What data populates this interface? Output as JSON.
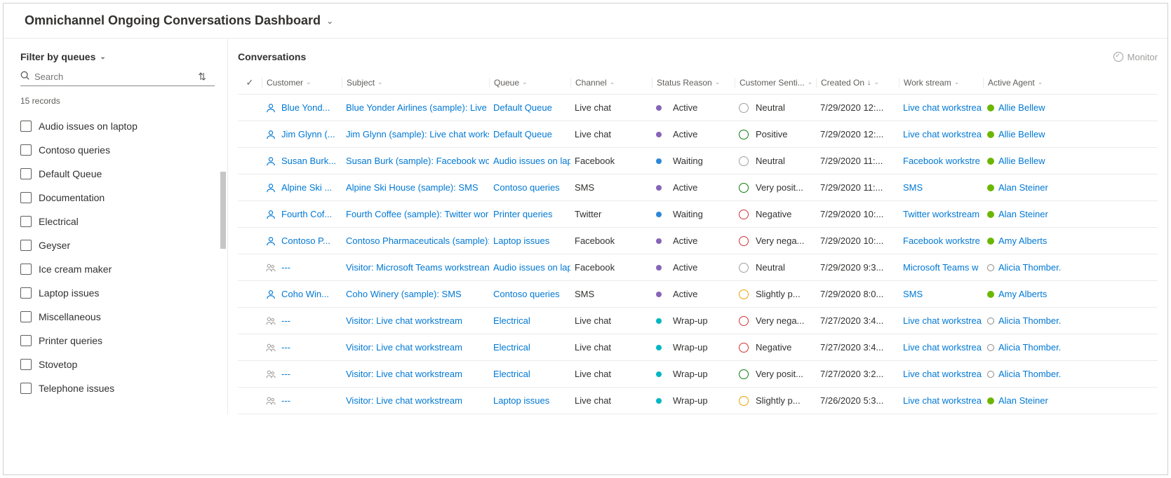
{
  "title": "Omnichannel Ongoing Conversations Dashboard",
  "sidebar": {
    "filter_label": "Filter by queues",
    "search_placeholder": "Search",
    "records": "15 records",
    "queues": [
      "Audio issues on laptop",
      "Contoso queries",
      "Default Queue",
      "Documentation",
      "Electrical",
      "Geyser",
      "Ice cream maker",
      "Laptop issues",
      "Miscellaneous",
      "Printer queries",
      "Stovetop",
      "Telephone issues"
    ]
  },
  "main": {
    "heading": "Conversations",
    "monitor": "Monitor",
    "columns": {
      "customer": "Customer",
      "subject": "Subject",
      "queue": "Queue",
      "channel": "Channel",
      "status": "Status Reason",
      "sentiment": "Customer Senti...",
      "created": "Created On",
      "work": "Work stream",
      "agent": "Active Agent"
    },
    "rows": [
      {
        "icon": "person",
        "customer": "Blue Yond...",
        "subject": "Blue Yonder Airlines (sample): Live c",
        "queue": "Default Queue",
        "channel": "Live chat",
        "status_dot": "purple",
        "status": "Active",
        "sent_face": "neutral",
        "sentiment": "Neutral",
        "created": "7/29/2020 12:...",
        "work": "Live chat workstrea",
        "agent_dot": "green",
        "agent": "Allie Bellew"
      },
      {
        "icon": "person",
        "customer": "Jim Glynn (...",
        "subject": "Jim Glynn (sample): Live chat works",
        "queue": "Default Queue",
        "channel": "Live chat",
        "status_dot": "purple",
        "status": "Active",
        "sent_face": "pos",
        "sentiment": "Positive",
        "created": "7/29/2020 12:...",
        "work": "Live chat workstrea",
        "agent_dot": "green",
        "agent": "Allie Bellew"
      },
      {
        "icon": "person",
        "customer": "Susan Burk...",
        "subject": "Susan Burk (sample): Facebook wor",
        "queue": "Audio issues on lap",
        "channel": "Facebook",
        "status_dot": "blue",
        "status": "Waiting",
        "sent_face": "neutral",
        "sentiment": "Neutral",
        "created": "7/29/2020 11:...",
        "work": "Facebook workstre",
        "agent_dot": "green",
        "agent": "Allie Bellew"
      },
      {
        "icon": "person",
        "customer": "Alpine Ski ...",
        "subject": "Alpine Ski House (sample): SMS",
        "queue": "Contoso queries",
        "channel": "SMS",
        "status_dot": "purple",
        "status": "Active",
        "sent_face": "pos",
        "sentiment": "Very posit...",
        "created": "7/29/2020 11:...",
        "work": "SMS",
        "agent_dot": "green",
        "agent": "Alan Steiner"
      },
      {
        "icon": "person",
        "customer": "Fourth Cof...",
        "subject": "Fourth Coffee (sample): Twitter wor",
        "queue": "Printer queries",
        "channel": "Twitter",
        "status_dot": "blue",
        "status": "Waiting",
        "sent_face": "neg",
        "sentiment": "Negative",
        "created": "7/29/2020 10:...",
        "work": "Twitter workstream",
        "agent_dot": "green",
        "agent": "Alan Steiner"
      },
      {
        "icon": "person",
        "customer": "Contoso P...",
        "subject": "Contoso Pharmaceuticals (sample):",
        "queue": "Laptop issues",
        "channel": "Facebook",
        "status_dot": "purple",
        "status": "Active",
        "sent_face": "neg",
        "sentiment": "Very nega...",
        "created": "7/29/2020 10:...",
        "work": "Facebook workstre",
        "agent_dot": "green",
        "agent": "Amy Alberts"
      },
      {
        "icon": "group",
        "customer": "---",
        "subject": "Visitor: Microsoft Teams workstrean",
        "queue": "Audio issues on lap",
        "channel": "Facebook",
        "status_dot": "purple",
        "status": "Active",
        "sent_face": "neutral",
        "sentiment": "Neutral",
        "created": "7/29/2020 9:3...",
        "work": "Microsoft Teams w",
        "agent_dot": "hollow",
        "agent": "Alicia Thomber."
      },
      {
        "icon": "person",
        "customer": "Coho Win...",
        "subject": "Coho Winery (sample): SMS",
        "queue": "Contoso queries",
        "channel": "SMS",
        "status_dot": "purple",
        "status": "Active",
        "sent_face": "slight",
        "sentiment": "Slightly p...",
        "created": "7/29/2020 8:0...",
        "work": "SMS",
        "agent_dot": "green",
        "agent": "Amy Alberts"
      },
      {
        "icon": "group",
        "customer": "---",
        "subject": "Visitor: Live chat workstream",
        "queue": "Electrical",
        "channel": "Live chat",
        "status_dot": "teal",
        "status": "Wrap-up",
        "sent_face": "neg",
        "sentiment": "Very nega...",
        "created": "7/27/2020 3:4...",
        "work": "Live chat workstrea",
        "agent_dot": "hollow",
        "agent": "Alicia Thomber."
      },
      {
        "icon": "group",
        "customer": "---",
        "subject": "Visitor: Live chat workstream",
        "queue": "Electrical",
        "channel": "Live chat",
        "status_dot": "teal",
        "status": "Wrap-up",
        "sent_face": "neg",
        "sentiment": "Negative",
        "created": "7/27/2020 3:4...",
        "work": "Live chat workstrea",
        "agent_dot": "hollow",
        "agent": "Alicia Thomber."
      },
      {
        "icon": "group",
        "customer": "---",
        "subject": "Visitor: Live chat workstream",
        "queue": "Electrical",
        "channel": "Live chat",
        "status_dot": "teal",
        "status": "Wrap-up",
        "sent_face": "pos",
        "sentiment": "Very posit...",
        "created": "7/27/2020 3:2...",
        "work": "Live chat workstrea",
        "agent_dot": "hollow",
        "agent": "Alicia Thomber."
      },
      {
        "icon": "group",
        "customer": "---",
        "subject": "Visitor: Live chat workstream",
        "queue": "Laptop issues",
        "channel": "Live chat",
        "status_dot": "teal",
        "status": "Wrap-up",
        "sent_face": "slight",
        "sentiment": "Slightly p...",
        "created": "7/26/2020 5:3...",
        "work": "Live chat workstrea",
        "agent_dot": "green",
        "agent": "Alan Steiner"
      }
    ]
  }
}
